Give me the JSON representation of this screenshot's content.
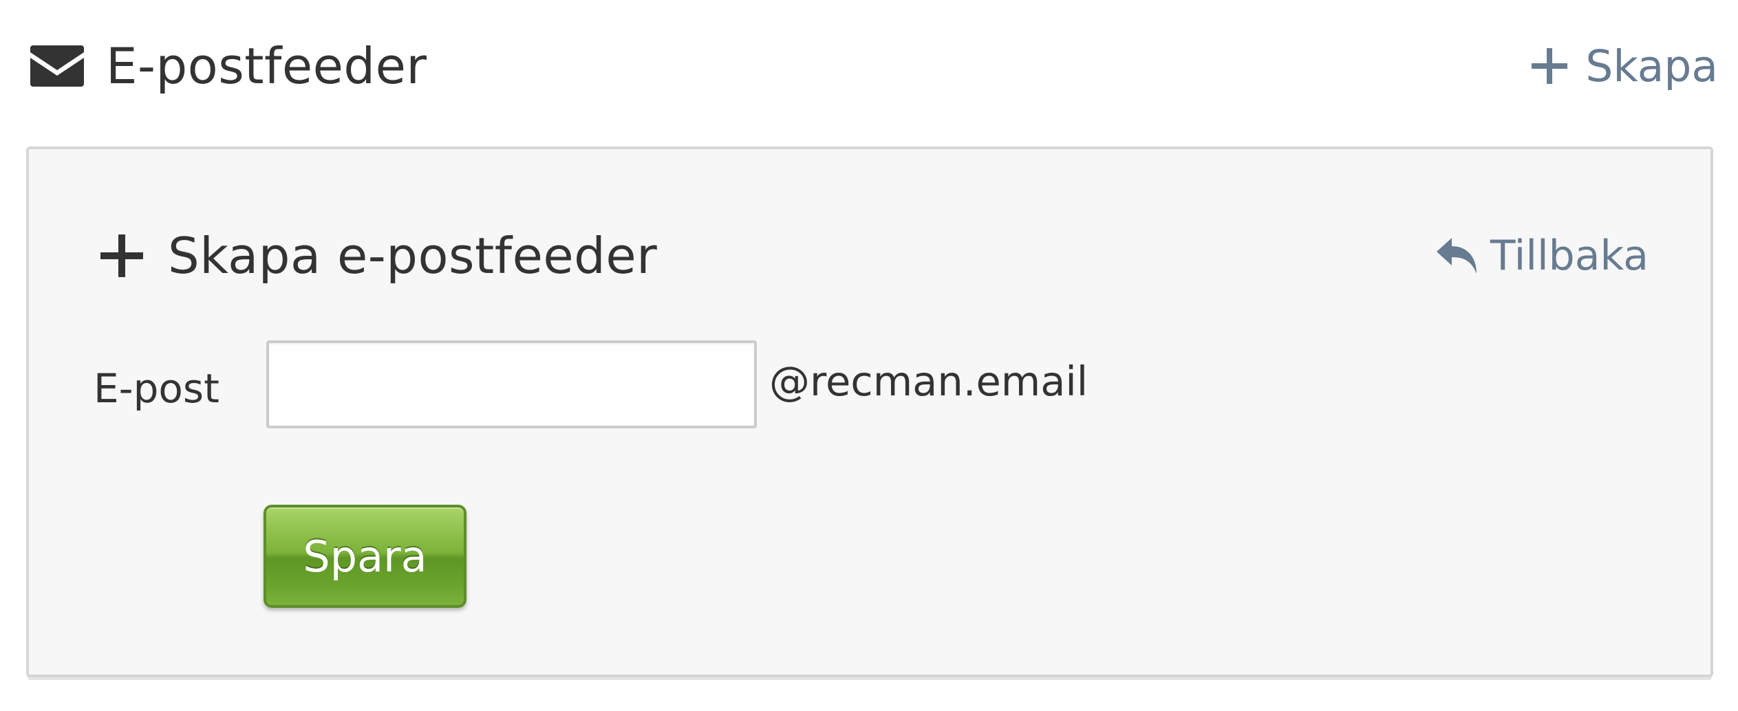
{
  "header": {
    "title": "E-postfeeder",
    "title_icon": "envelope-icon",
    "create_link": {
      "label": "Skapa",
      "icon": "plus-icon"
    }
  },
  "panel": {
    "title": "Skapa e-postfeeder",
    "title_icon": "plus-icon",
    "back_link": {
      "label": "Tillbaka",
      "icon": "reply-icon"
    },
    "form": {
      "email_label": "E-post",
      "email_value": "",
      "email_placeholder": "",
      "email_suffix": "@recman.email",
      "save_label": "Spara"
    }
  },
  "colors": {
    "text": "#333333",
    "link": "#677b91",
    "panel_bg": "#f7f7f7",
    "panel_border": "#d6d6d6",
    "button_green": "#7cb33a",
    "button_border": "#5f8e2a"
  }
}
